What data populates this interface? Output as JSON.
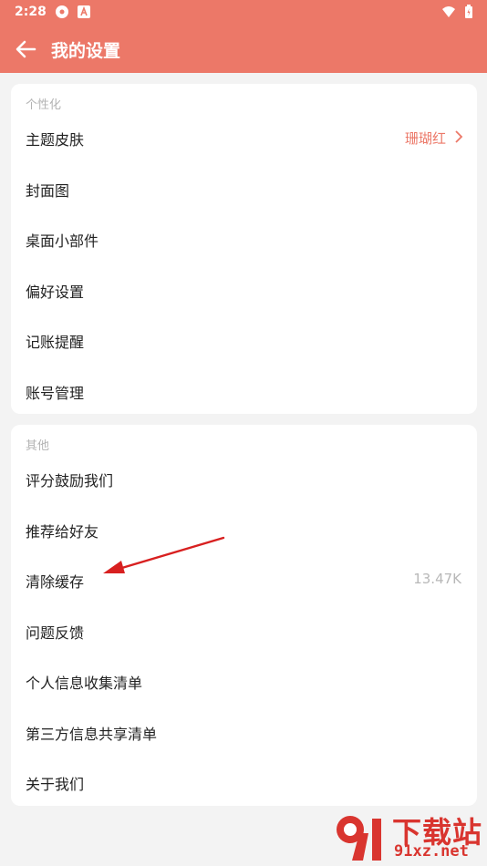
{
  "status_bar": {
    "time": "2:28"
  },
  "header": {
    "title": "我的设置",
    "color": "#ec7868"
  },
  "sections": [
    {
      "title": "个性化",
      "items": [
        {
          "label": "主题皮肤",
          "value": "珊瑚红",
          "chevron": true
        },
        {
          "label": "封面图"
        },
        {
          "label": "桌面小部件"
        },
        {
          "label": "偏好设置"
        },
        {
          "label": "记账提醒"
        },
        {
          "label": "账号管理"
        }
      ]
    },
    {
      "title": "其他",
      "items": [
        {
          "label": "评分鼓励我们"
        },
        {
          "label": "推荐给好友"
        },
        {
          "label": "清除缓存",
          "value": "13.47K"
        },
        {
          "label": "问题反馈"
        },
        {
          "label": "个人信息收集清单"
        },
        {
          "label": "第三方信息共享清单"
        },
        {
          "label": "关于我们"
        }
      ]
    }
  ],
  "watermark": {
    "title": "下载站",
    "url": "91xz.net"
  }
}
